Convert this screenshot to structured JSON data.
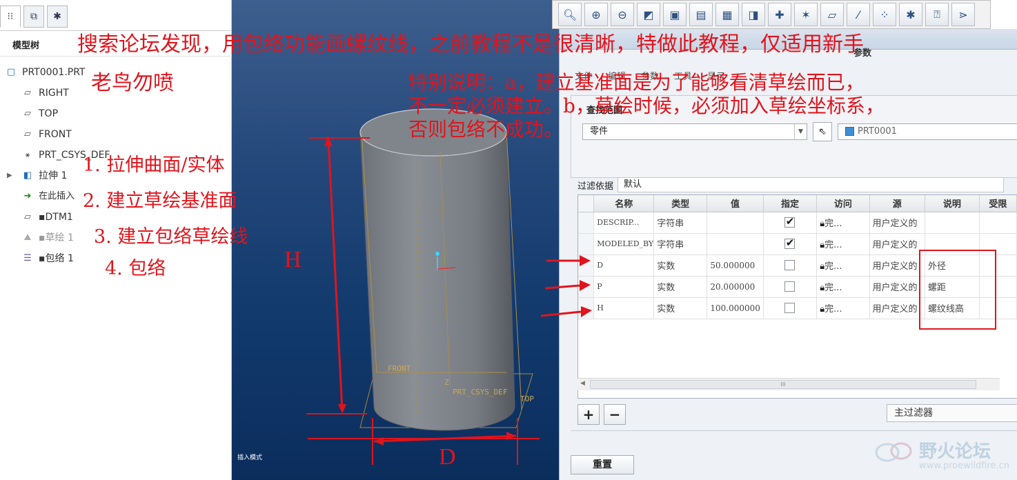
{
  "tree": {
    "tab_icons": [
      "model-tree-icon",
      "layer-icon",
      "settings-icon"
    ],
    "title": "模型树",
    "items": [
      {
        "label": "PRT0001.PRT",
        "icon": "part-icon"
      },
      {
        "label": "RIGHT",
        "icon": "datum-plane-icon"
      },
      {
        "label": "TOP",
        "icon": "datum-plane-icon"
      },
      {
        "label": "FRONT",
        "icon": "datum-plane-icon"
      },
      {
        "label": "PRT_CSYS_DEF",
        "icon": "csys-icon"
      },
      {
        "label": "拉伸 1",
        "icon": "extrude-icon"
      },
      {
        "label": "在此插入",
        "icon": "insert-here-icon"
      },
      {
        "label": "▪DTM1",
        "icon": "datum-plane-icon"
      },
      {
        "label": "▪草绘 1",
        "icon": "sketch-icon"
      },
      {
        "label": "▪包络 1",
        "icon": "wrap-icon"
      }
    ]
  },
  "viewport": {
    "labels": {
      "front": "FRONT",
      "csys": "PRT_CSYS_DEF",
      "top": "TOP",
      "z_axis": "Z"
    },
    "footer": "插入模式"
  },
  "toolbar": {
    "buttons": [
      "zoom-fit-icon",
      "zoom-in-icon",
      "zoom-out-icon",
      "repaint-icon",
      "display-style-icon",
      "saved-views-icon",
      "view-manager-icon",
      "perspective-icon",
      "spin-center-icon",
      "datum-display-icon",
      "plane-display-icon",
      "axis-display-icon",
      "point-display-icon",
      "csys-display-icon",
      "annotation-display-icon",
      "appearance-icon"
    ]
  },
  "dialog": {
    "title": "参数",
    "menu": [
      "文件",
      "编辑",
      "参数",
      "工具",
      "显示"
    ],
    "scope_label": "查找范围",
    "scope_value": "零件",
    "part_name": "PRT0001",
    "filter_label": "过滤依据",
    "filter_value": "默认",
    "columns": [
      "名称",
      "类型",
      "值",
      "指定",
      "访问",
      "源",
      "说明",
      "受限"
    ],
    "rows": [
      {
        "name": "DESCRIP...",
        "type": "字符串",
        "value": "",
        "designated": true,
        "access": "完...",
        "source": "用户定义的",
        "desc": ""
      },
      {
        "name": "MODELED_BY",
        "type": "字符串",
        "value": "",
        "designated": true,
        "access": "完...",
        "source": "用户定义的",
        "desc": ""
      },
      {
        "name": "D",
        "type": "实数",
        "value": "50.000000",
        "designated": false,
        "access": "完...",
        "source": "用户定义的",
        "desc": "外径"
      },
      {
        "name": "P",
        "type": "实数",
        "value": "20.000000",
        "designated": false,
        "access": "完...",
        "source": "用户定义的",
        "desc": "螺距"
      },
      {
        "name": "H",
        "type": "实数",
        "value": "100.000000",
        "designated": false,
        "access": "完...",
        "source": "用户定义的",
        "desc": "螺纹线高"
      }
    ],
    "scroll_thumb": "III",
    "add_label": "+",
    "remove_label": "−",
    "main_filter": "主过滤器",
    "reset_label": "重置"
  },
  "annotations": {
    "headline": "搜索论坛发现，用包络功能画螺纹线，之前教程不是很清晰，特做此教程，仅适用新手",
    "sub": "老鸟勿喷",
    "steps": [
      "1. 拉伸曲面/实体",
      "2. 建立草绘基准面",
      "3. 建立包络草绘线",
      "4. 包络"
    ],
    "note": [
      "特别说明：a，建立基准面是为了能够看清草绘而已，",
      "不一定必须建立。b，草绘时候，必须加入草绘坐标系，",
      "否则包络不成功。"
    ],
    "dim_h": "H",
    "dim_d": "D",
    "accent_color": "#e0141c"
  },
  "watermark": {
    "text": "野火论坛",
    "url": "www.proewildfire.cn"
  }
}
